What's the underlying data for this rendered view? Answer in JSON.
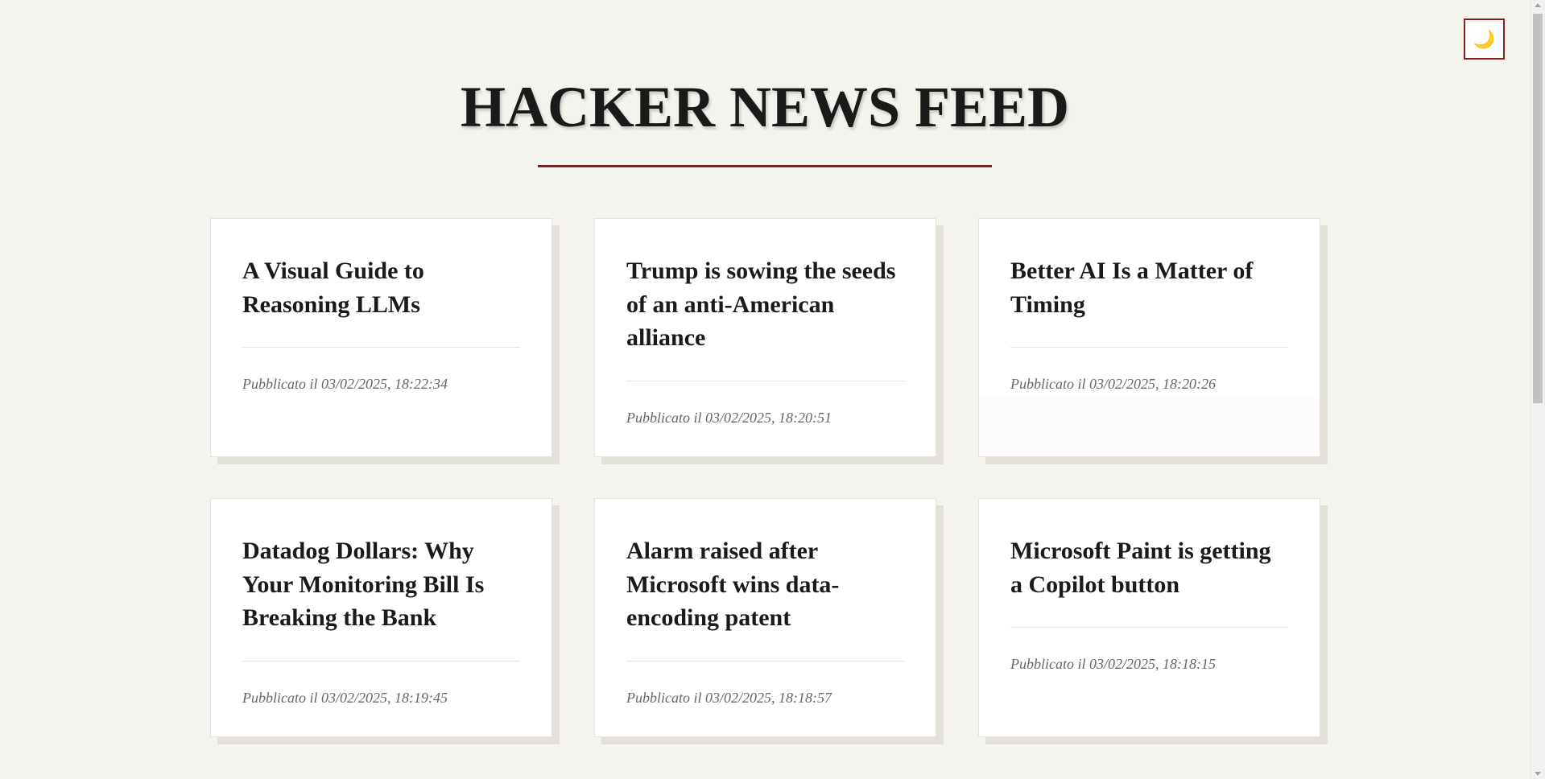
{
  "header": {
    "title": "HACKER NEWS FEED",
    "theme_toggle_icon": "🌙"
  },
  "colors": {
    "accent": "#8b1a1a",
    "background": "#f4f3ed",
    "card": "#ffffff"
  },
  "cards": [
    {
      "title": "A Visual Guide to Reasoning LLMs",
      "date": "Pubblicato il 03/02/2025, 18:22:34"
    },
    {
      "title": "Trump is sowing the seeds of an anti-American alliance",
      "date": "Pubblicato il 03/02/2025, 18:20:51"
    },
    {
      "title": "Better AI Is a Matter of Timing",
      "date": "Pubblicato il 03/02/2025, 18:20:26"
    },
    {
      "title": "Datadog Dollars: Why Your Monitoring Bill Is Breaking the Bank",
      "date": "Pubblicato il 03/02/2025, 18:19:45"
    },
    {
      "title": "Alarm raised after Microsoft wins data-encoding patent",
      "date": "Pubblicato il 03/02/2025, 18:18:57"
    },
    {
      "title": "Microsoft Paint is getting a Copilot button",
      "date": "Pubblicato il 03/02/2025, 18:18:15"
    }
  ]
}
